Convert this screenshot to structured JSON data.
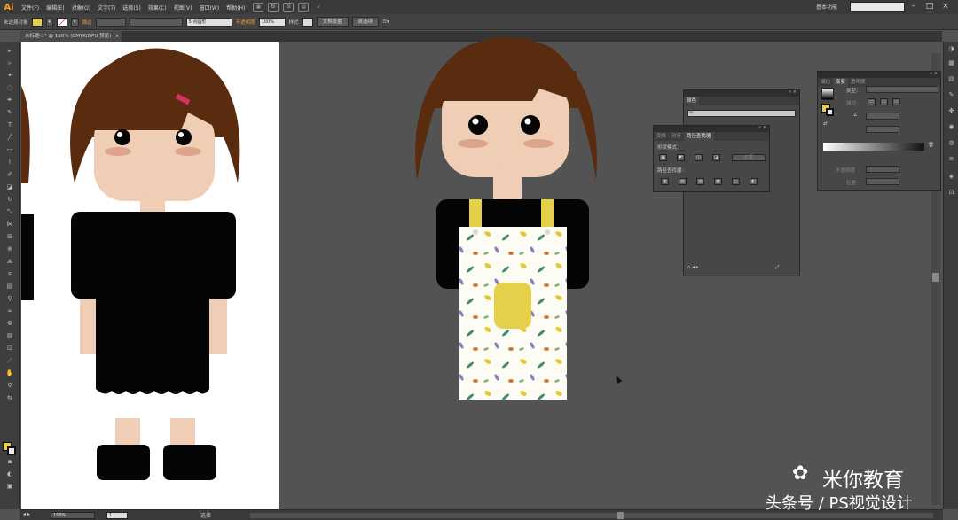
{
  "app": {
    "logo": "Ai"
  },
  "menubar": {
    "items": [
      "文件(F)",
      "编辑(E)",
      "对象(O)",
      "文字(T)",
      "选择(S)",
      "效果(C)",
      "视图(V)",
      "窗口(W)",
      "帮助(H)"
    ],
    "icons": [
      "Br",
      "St"
    ],
    "workspace": "基本功能"
  },
  "controlbar": {
    "selection": "未选择对象",
    "fill_color": "#e6d04a",
    "stroke_label": "描边",
    "brush_value": "5 点圆形",
    "opacity_label": "不透明度",
    "opacity_value": "100%",
    "style_label": "样式",
    "doc_setup": "文档设置",
    "preferences": "首选项"
  },
  "document": {
    "tab": "未标题-1* @ 150% (CMYK/GPU 预览)",
    "close": "×"
  },
  "statusbar": {
    "zoom": "150%",
    "page": "1",
    "status": "选择"
  },
  "panels": {
    "color": {
      "tab": "颜色"
    },
    "pathfinder": {
      "tabs": [
        "变换",
        "对齐",
        "路径查找器"
      ],
      "shape_modes": "形状模式：",
      "expand": "扩展",
      "pathfinders": "路径查找器："
    },
    "gradient": {
      "tabs": [
        "描边",
        "渐变",
        "透明度"
      ],
      "type_label": "类型：",
      "stroke_label": "描边",
      "opacity_label": "不透明度",
      "location_label": "位置"
    }
  },
  "watermark": {
    "line1": "米你教育",
    "line2": "头条号 / PS视觉设计"
  },
  "colors": {
    "hair": "#5a2c0f",
    "skin": "#f0cdb5",
    "shirt": "#050505",
    "apron_strap": "#e6d04a",
    "pocket": "#e6d04a",
    "cheek": "#dca48c"
  }
}
